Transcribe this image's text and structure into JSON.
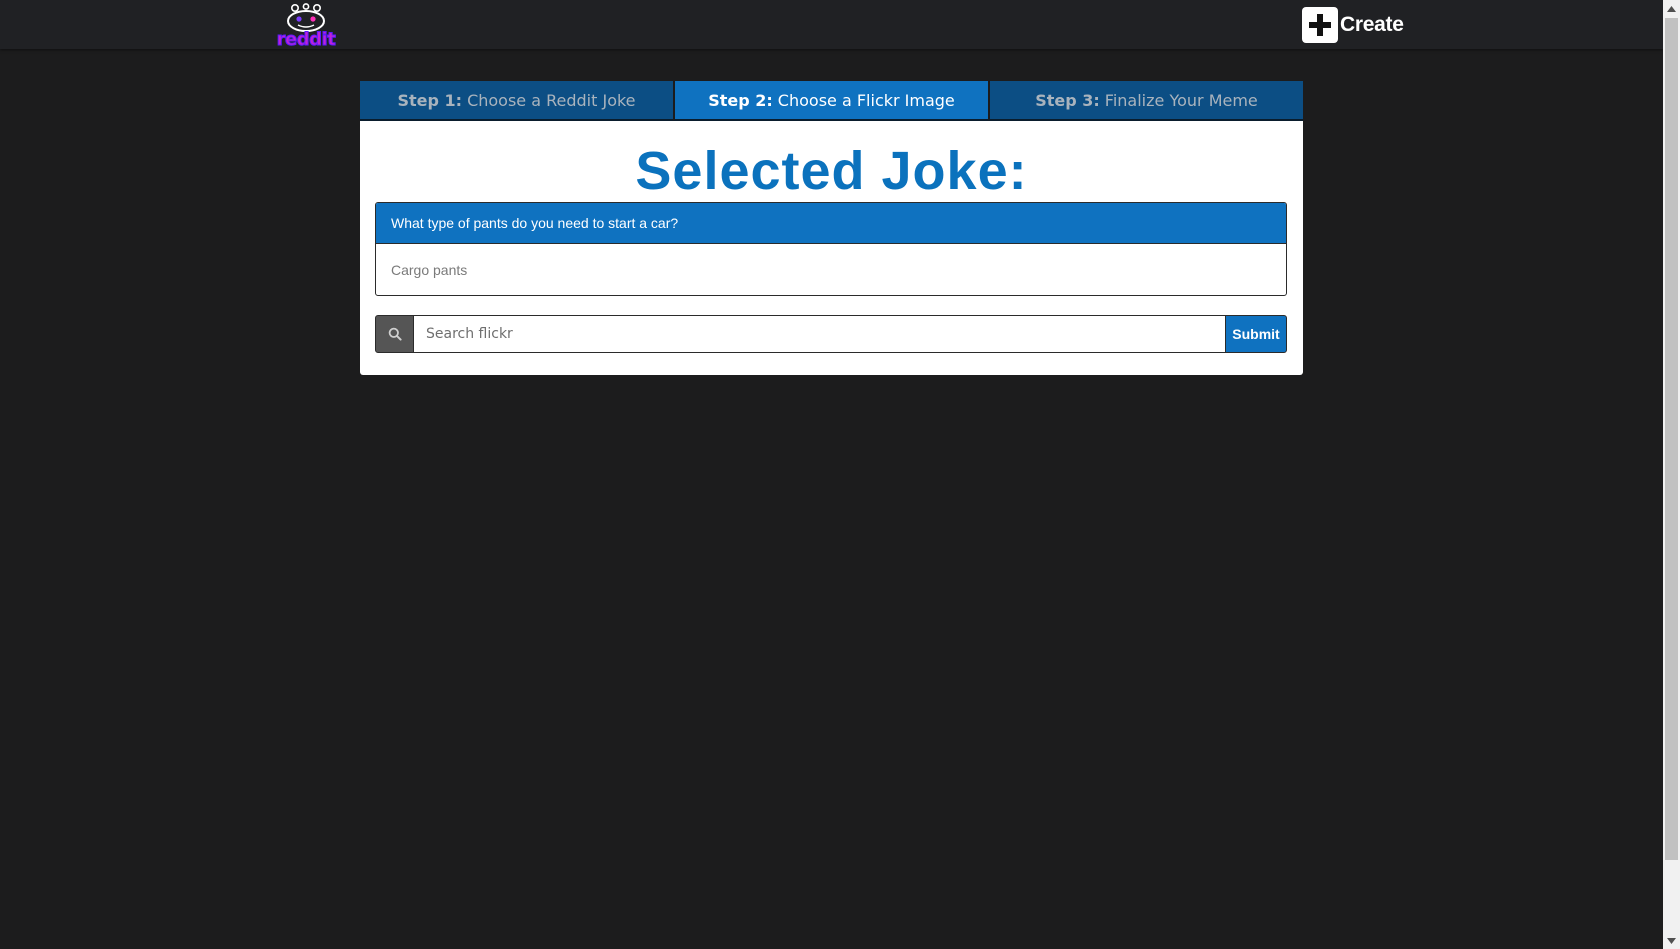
{
  "navbar": {
    "logo_alt": "reddit",
    "create_label": "Create"
  },
  "steps": [
    {
      "number": "Step 1:",
      "label": "Choose a Reddit Joke",
      "active": false
    },
    {
      "number": "Step 2:",
      "label": "Choose a Flickr Image",
      "active": true
    },
    {
      "number": "Step 3:",
      "label": "Finalize Your Meme",
      "active": false
    }
  ],
  "card": {
    "title": "Selected Joke:",
    "joke": {
      "question": "What type of pants do you need to start a car?",
      "answer": "Cargo pants"
    },
    "search": {
      "placeholder": "Search flickr",
      "value": "",
      "icon": "search-icon",
      "submit_label": "Submit"
    }
  },
  "colors": {
    "page_bg": "#1c1c1d",
    "navbar_bg": "#202124",
    "accent": "#0f72c0",
    "step_inactive": "#0c4e84",
    "title_blue": "#0b72bd"
  }
}
